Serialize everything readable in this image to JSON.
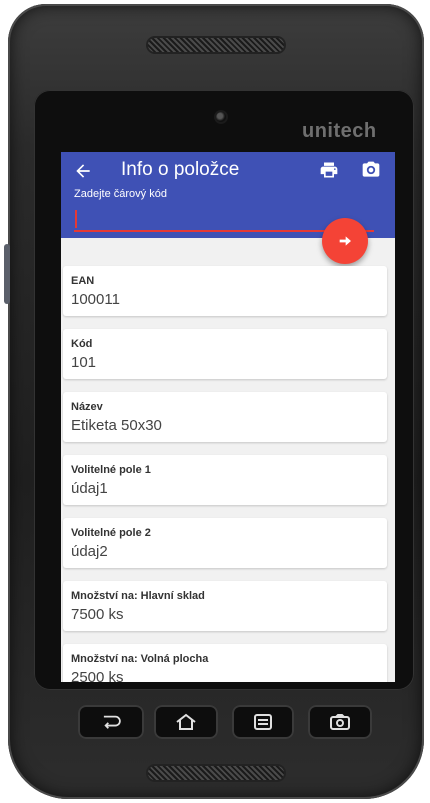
{
  "device": {
    "brand": "unitech"
  },
  "appbar": {
    "title": "Info o položce",
    "back_icon": "arrow-left-icon",
    "print_icon": "printer-icon",
    "camera_icon": "camera-icon",
    "color": "#3f51b5"
  },
  "barcode": {
    "label": "Zadejte čárový kód",
    "value": ""
  },
  "fab": {
    "icon": "arrow-right-icon",
    "color": "#f44336"
  },
  "cards": [
    {
      "label": "EAN",
      "value": "100011"
    },
    {
      "label": "Kód",
      "value": "101"
    },
    {
      "label": "Název",
      "value": "Etiketa 50x30"
    },
    {
      "label": "Volitelné pole 1",
      "value": "údaj1"
    },
    {
      "label": "Volitelné pole 2",
      "value": "údaj2"
    },
    {
      "label": "Množství na: Hlavní sklad",
      "value": "7500 ks"
    },
    {
      "label": "Množství na: Volná plocha",
      "value": "2500 ks"
    }
  ],
  "navbar": [
    "back-icon",
    "home-icon",
    "menu-icon",
    "camera-icon"
  ]
}
